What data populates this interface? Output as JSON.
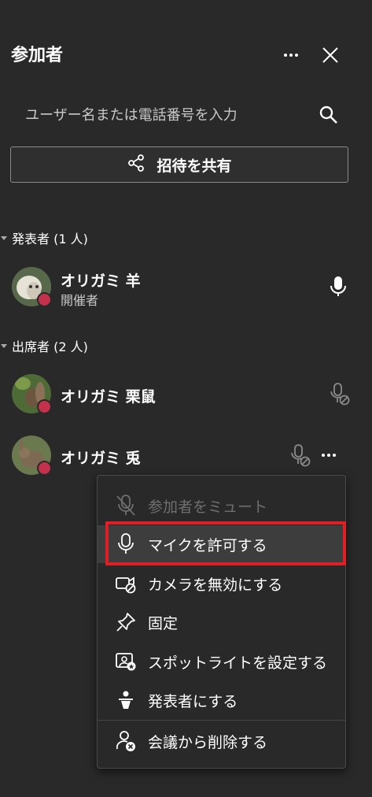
{
  "panel": {
    "title": "参加者",
    "search_placeholder": "ユーザー名または電話番号を入力",
    "invite_label": "招待を共有"
  },
  "sections": [
    {
      "label": "発表者 (1 人)"
    },
    {
      "label": "出席者 (2 人)"
    }
  ],
  "participants": [
    {
      "name": "オリガミ 羊",
      "role": "開催者"
    },
    {
      "name": "オリガミ 栗鼠"
    },
    {
      "name": "オリガミ 兎"
    }
  ],
  "context_menu": {
    "items": [
      {
        "label": "参加者をミュート",
        "icon": "mic-off-icon",
        "disabled": true
      },
      {
        "label": "マイクを許可する",
        "icon": "mic-icon"
      },
      {
        "label": "カメラを無効にする",
        "icon": "camera-off-icon"
      },
      {
        "label": "固定",
        "icon": "pin-icon"
      },
      {
        "label": "スポットライトを設定する",
        "icon": "spotlight-icon"
      },
      {
        "label": "発表者にする",
        "icon": "presenter-icon"
      },
      {
        "label": "会議から削除する",
        "icon": "remove-person-icon"
      }
    ]
  },
  "colors": {
    "background": "#292929",
    "status_red": "#c4314b",
    "highlight_border": "#e01e24"
  }
}
